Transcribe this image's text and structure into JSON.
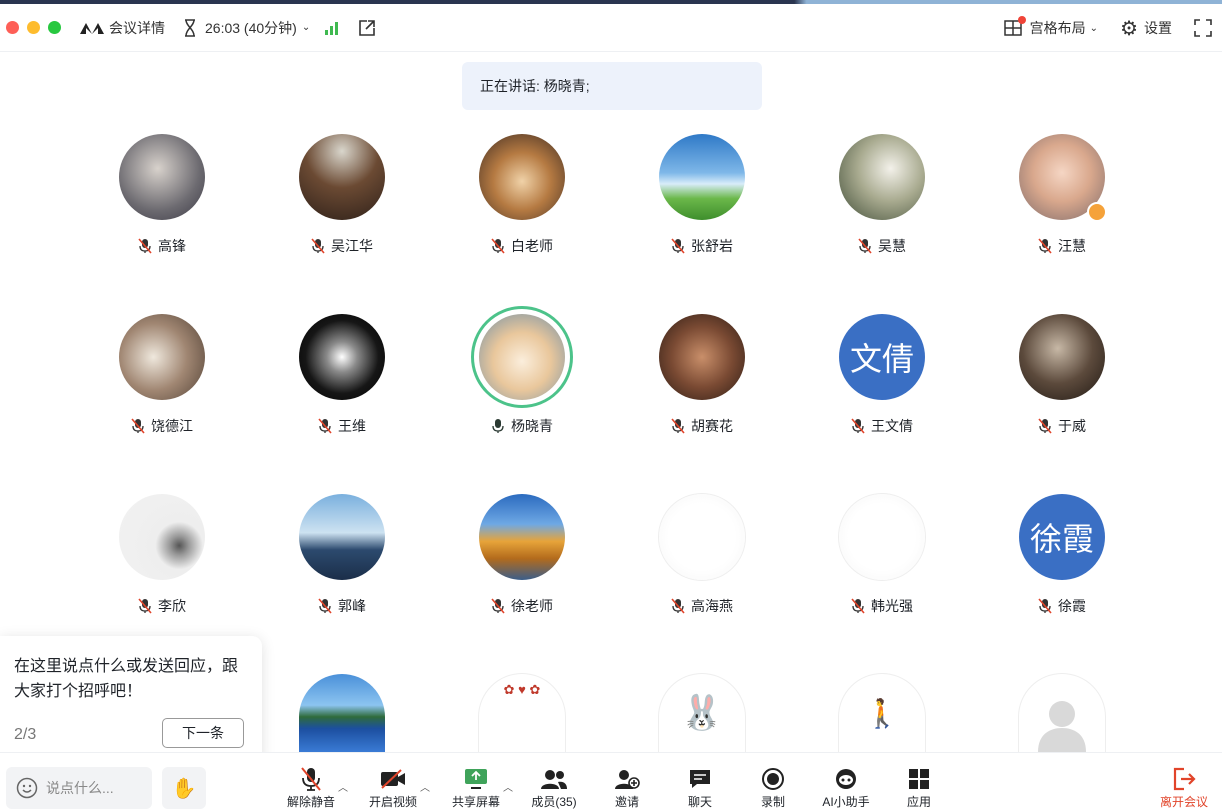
{
  "header": {
    "meeting_details": "会议详情",
    "timer": "26:03 (40分钟)",
    "layout": "宫格布局",
    "settings": "设置"
  },
  "speaking": "正在讲话: 杨晓青;",
  "participants": [
    {
      "name": "高锋",
      "muted": true
    },
    {
      "name": "吴江华",
      "muted": true
    },
    {
      "name": "白老师",
      "muted": true
    },
    {
      "name": "张舒岩",
      "muted": true
    },
    {
      "name": "吴慧",
      "muted": true
    },
    {
      "name": "汪慧",
      "muted": true
    },
    {
      "name": "饶德江",
      "muted": true
    },
    {
      "name": "王维",
      "muted": true
    },
    {
      "name": "杨晓青",
      "muted": false
    },
    {
      "name": "胡赛花",
      "muted": true
    },
    {
      "name": "王文倩",
      "muted": true,
      "avatar_text": "文倩"
    },
    {
      "name": "于威",
      "muted": true
    },
    {
      "name": "李欣",
      "muted": true
    },
    {
      "name": "郭峰",
      "muted": true
    },
    {
      "name": "徐老师",
      "muted": true
    },
    {
      "name": "高海燕",
      "muted": true
    },
    {
      "name": "韩光强",
      "muted": true
    },
    {
      "name": "徐霞",
      "muted": true,
      "avatar_text": "徐霞"
    }
  ],
  "tip": {
    "text": "在这里说点什么或发送回应，跟大家打个招呼吧！",
    "page": "2/3",
    "next": "下一条"
  },
  "chat": {
    "placeholder": "说点什么..."
  },
  "toolbar": {
    "unmute": "解除静音",
    "video": "开启视频",
    "share": "共享屏幕",
    "members": "成员(35)",
    "invite": "邀请",
    "chat": "聊天",
    "record": "录制",
    "ai": "AI小助手",
    "apps": "应用",
    "leave": "离开会议"
  },
  "colors": {
    "accent": "#3a6fc4",
    "leave": "#e1442a",
    "active_ring": "#4cc38a"
  }
}
